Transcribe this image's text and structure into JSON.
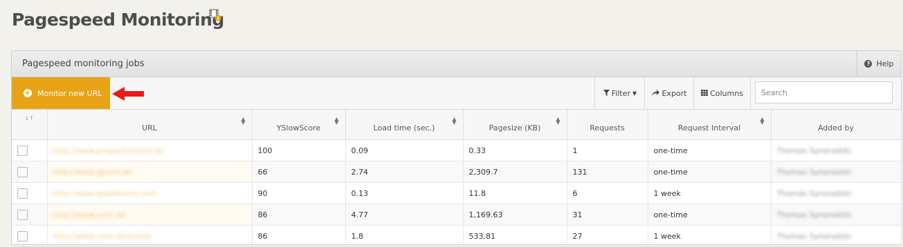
{
  "page": {
    "title": "Pagespeed Monitoring",
    "title_icon": "film-info-icon"
  },
  "panel": {
    "title": "Pagespeed monitoring jobs",
    "help_label": "Help"
  },
  "toolbar": {
    "monitor_label": "Monitor new URL",
    "filter_label": "Filter",
    "export_label": "Export",
    "columns_label": "Columns",
    "search_placeholder": "Search",
    "accent_color": "#e8a317",
    "arrow_color": "#e81a1a"
  },
  "table": {
    "select_header": "↓↑",
    "headers": {
      "url": "URL",
      "yslow": "YSlowScore",
      "load": "Load time (sec.)",
      "pagesize": "Pagesize (KB)",
      "requests": "Requests",
      "interval": "Request Interval",
      "added": "Added by"
    },
    "rows": [
      {
        "url": "http://www.prepaid-hoster.de",
        "yslow": "100",
        "load": "0.09",
        "pagesize": "0.33",
        "requests": "1",
        "interval": "one-time",
        "added": "Thomas Synoradzki"
      },
      {
        "url": "http://www.golem.de",
        "yslow": "66",
        "load": "2.74",
        "pagesize": "2,309.7",
        "requests": "131",
        "interval": "one-time",
        "added": "Thomas Synoradzki"
      },
      {
        "url": "http://www.djwebtorte.com",
        "yslow": "90",
        "load": "0.13",
        "pagesize": "11.8",
        "requests": "6",
        "interval": "1 week",
        "added": "Thomas Synoradzki"
      },
      {
        "url": "http://www.vorn.de",
        "yslow": "86",
        "load": "4.77",
        "pagesize": "1,169.63",
        "requests": "31",
        "interval": "one-time",
        "added": "Thomas Synoradzki"
      },
      {
        "url": "http://www.vorn.de/preise",
        "yslow": "86",
        "load": "1.8",
        "pagesize": "533.81",
        "requests": "27",
        "interval": "1 week",
        "added": "Thomas Synoradzki"
      }
    ]
  }
}
